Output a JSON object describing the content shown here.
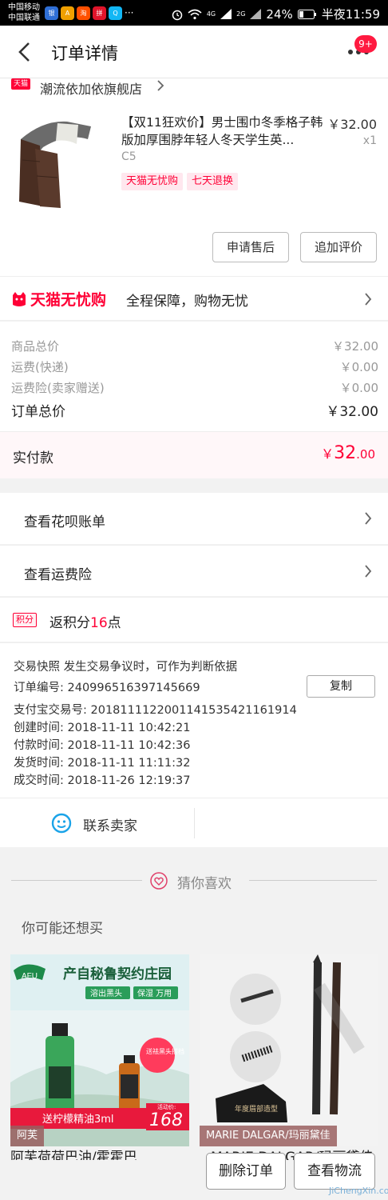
{
  "status_bar": {
    "carrier1": "中国移动",
    "carrier2": "中国联通",
    "app_icons": [
      "银",
      "A",
      "淘",
      "拼",
      "Q"
    ],
    "app_icon_colors": [
      "#2f6fd6",
      "#f0a000",
      "#ff5000",
      "#e0142a",
      "#12b7f5"
    ],
    "more_label": "···",
    "battery": "24%",
    "time": "半夜11:59",
    "signal1": "4G",
    "signal2": "2G"
  },
  "header": {
    "title": "订单详情",
    "badge": "9+"
  },
  "shop": {
    "logo": "天猫",
    "name": "潮流依加依旗舰店"
  },
  "product": {
    "title": "【双11狂欢价】男士围巾冬季格子韩版加厚围脖年轻人冬天学生英...",
    "sku": "C5",
    "price": "￥32.00",
    "qty": "x1",
    "tags": [
      "天猫无忧购",
      "七天退换"
    ],
    "btn_after_sale": "申请售后",
    "btn_review": "追加评价"
  },
  "guarantee": {
    "logo_text": "天猫无忧购",
    "text": "全程保障，购物无忧"
  },
  "prices": {
    "rows": [
      {
        "label": "商品总价",
        "value": "￥32.00"
      },
      {
        "label": "运费(快递)",
        "value": "￥0.00"
      },
      {
        "label": "运费险(卖家赠送)",
        "value": "￥0.00"
      }
    ],
    "total_label": "订单总价",
    "total_value": "￥32.00"
  },
  "paid": {
    "label": "实付款",
    "currency": "￥",
    "int": "32",
    "dec": ".00"
  },
  "links": {
    "huabei": "查看花呗账单",
    "freight": "查看运费险"
  },
  "points": {
    "tag": "积分",
    "prefix": "返积分",
    "num": "16",
    "suffix": "点"
  },
  "tx": {
    "snapshot": "交易快照  发生交易争议时，可作为判断依据",
    "order_no": "订单编号: 240996516397145669",
    "copy": "复制",
    "alipay_no": "支付宝交易号: 2018111122001141535421161914",
    "created": "创建时间: 2018-11-11 10:42:21",
    "paid": "付款时间: 2018-11-11 10:42:36",
    "shipped": "发货时间: 2018-11-11 11:11:32",
    "closed": "成交时间: 2018-11-26 12:19:37"
  },
  "contact": {
    "label": "联系卖家"
  },
  "guess": {
    "title": "猜你喜欢",
    "maybe": "你可能还想买"
  },
  "recs": [
    {
      "brand_badge": "AFU",
      "headline": "产自秘鲁契约庄园",
      "chip1": "溶出黑头",
      "chip2": "保湿 万用",
      "sticker": "送祛黑头搭档",
      "promo": "送柠檬精油3ml",
      "promo_tag": "活动价:",
      "promo_price": "168",
      "label": "阿芙",
      "title": "阿芙荷荷巴油/霍霍巴"
    },
    {
      "sub_caption": "年度眉部造型",
      "label": "MARIE DALGAR/玛丽黛佳",
      "title": "MARIE DALGAR/玛丽黛佳"
    }
  ],
  "bottom": {
    "delete": "删除订单",
    "logistics": "查看物流"
  },
  "watermark": "JiChengXin.com"
}
